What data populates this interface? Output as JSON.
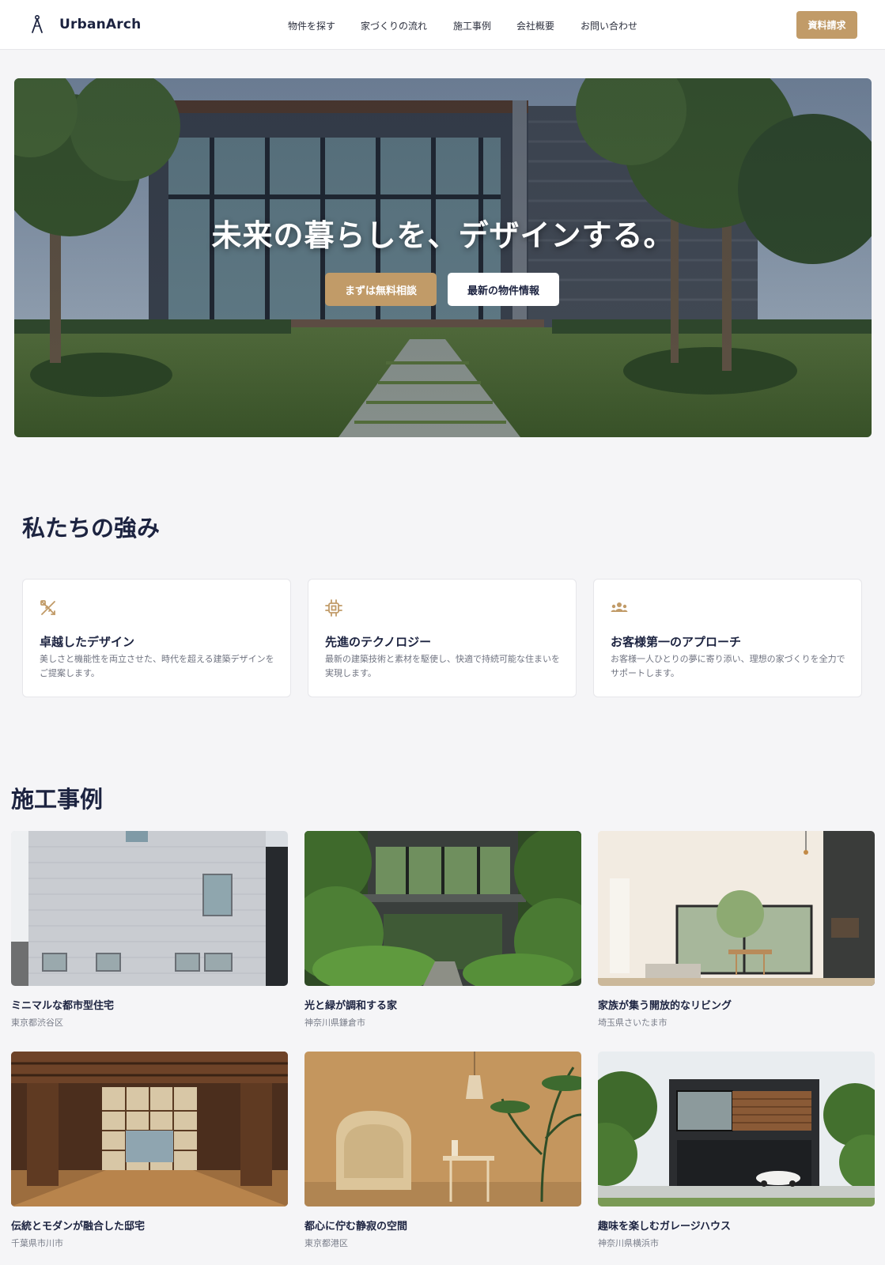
{
  "header": {
    "brand": "UrbanArch",
    "nav": [
      "物件を探す",
      "家づくりの流れ",
      "施工事例",
      "会社概要",
      "お問い合わせ"
    ],
    "cta_label": "資料請求"
  },
  "hero": {
    "title": "未来の暮らしを、デザインする。",
    "primary_button": "まずは無料相談",
    "secondary_button": "最新の物件情報"
  },
  "strengths": {
    "heading": "私たちの強み",
    "cards": [
      {
        "title": "卓越したデザイン",
        "text": "美しさと機能性を両立させた、時代を超える建築デザインをご提案します。",
        "icon": "design-tools-icon"
      },
      {
        "title": "先進のテクノロジー",
        "text": "最新の建築技術と素材を駆使し、快適で持続可能な住まいを実現します。",
        "icon": "chip-icon"
      },
      {
        "title": "お客様第一のアプローチ",
        "text": "お客様一人ひとりの夢に寄り添い、理想の家づくりを全力でサポートします。",
        "icon": "people-icon"
      }
    ]
  },
  "works": {
    "heading": "施工事例",
    "items": [
      {
        "title": "ミニマルな都市型住宅",
        "location": "東京都渋谷区"
      },
      {
        "title": "光と緑が調和する家",
        "location": "神奈川県鎌倉市"
      },
      {
        "title": "家族が集う開放的なリビング",
        "location": "埼玉県さいたま市"
      },
      {
        "title": "伝統とモダンが融合した邸宅",
        "location": "千葉県市川市"
      },
      {
        "title": "都心に佇む静寂の空間",
        "location": "東京都港区"
      },
      {
        "title": "趣味を楽しむガレージハウス",
        "location": "神奈川県横浜市"
      }
    ]
  },
  "colors": {
    "accent": "#c19b68",
    "navy": "#1c2340",
    "background": "#f5f5f7"
  }
}
